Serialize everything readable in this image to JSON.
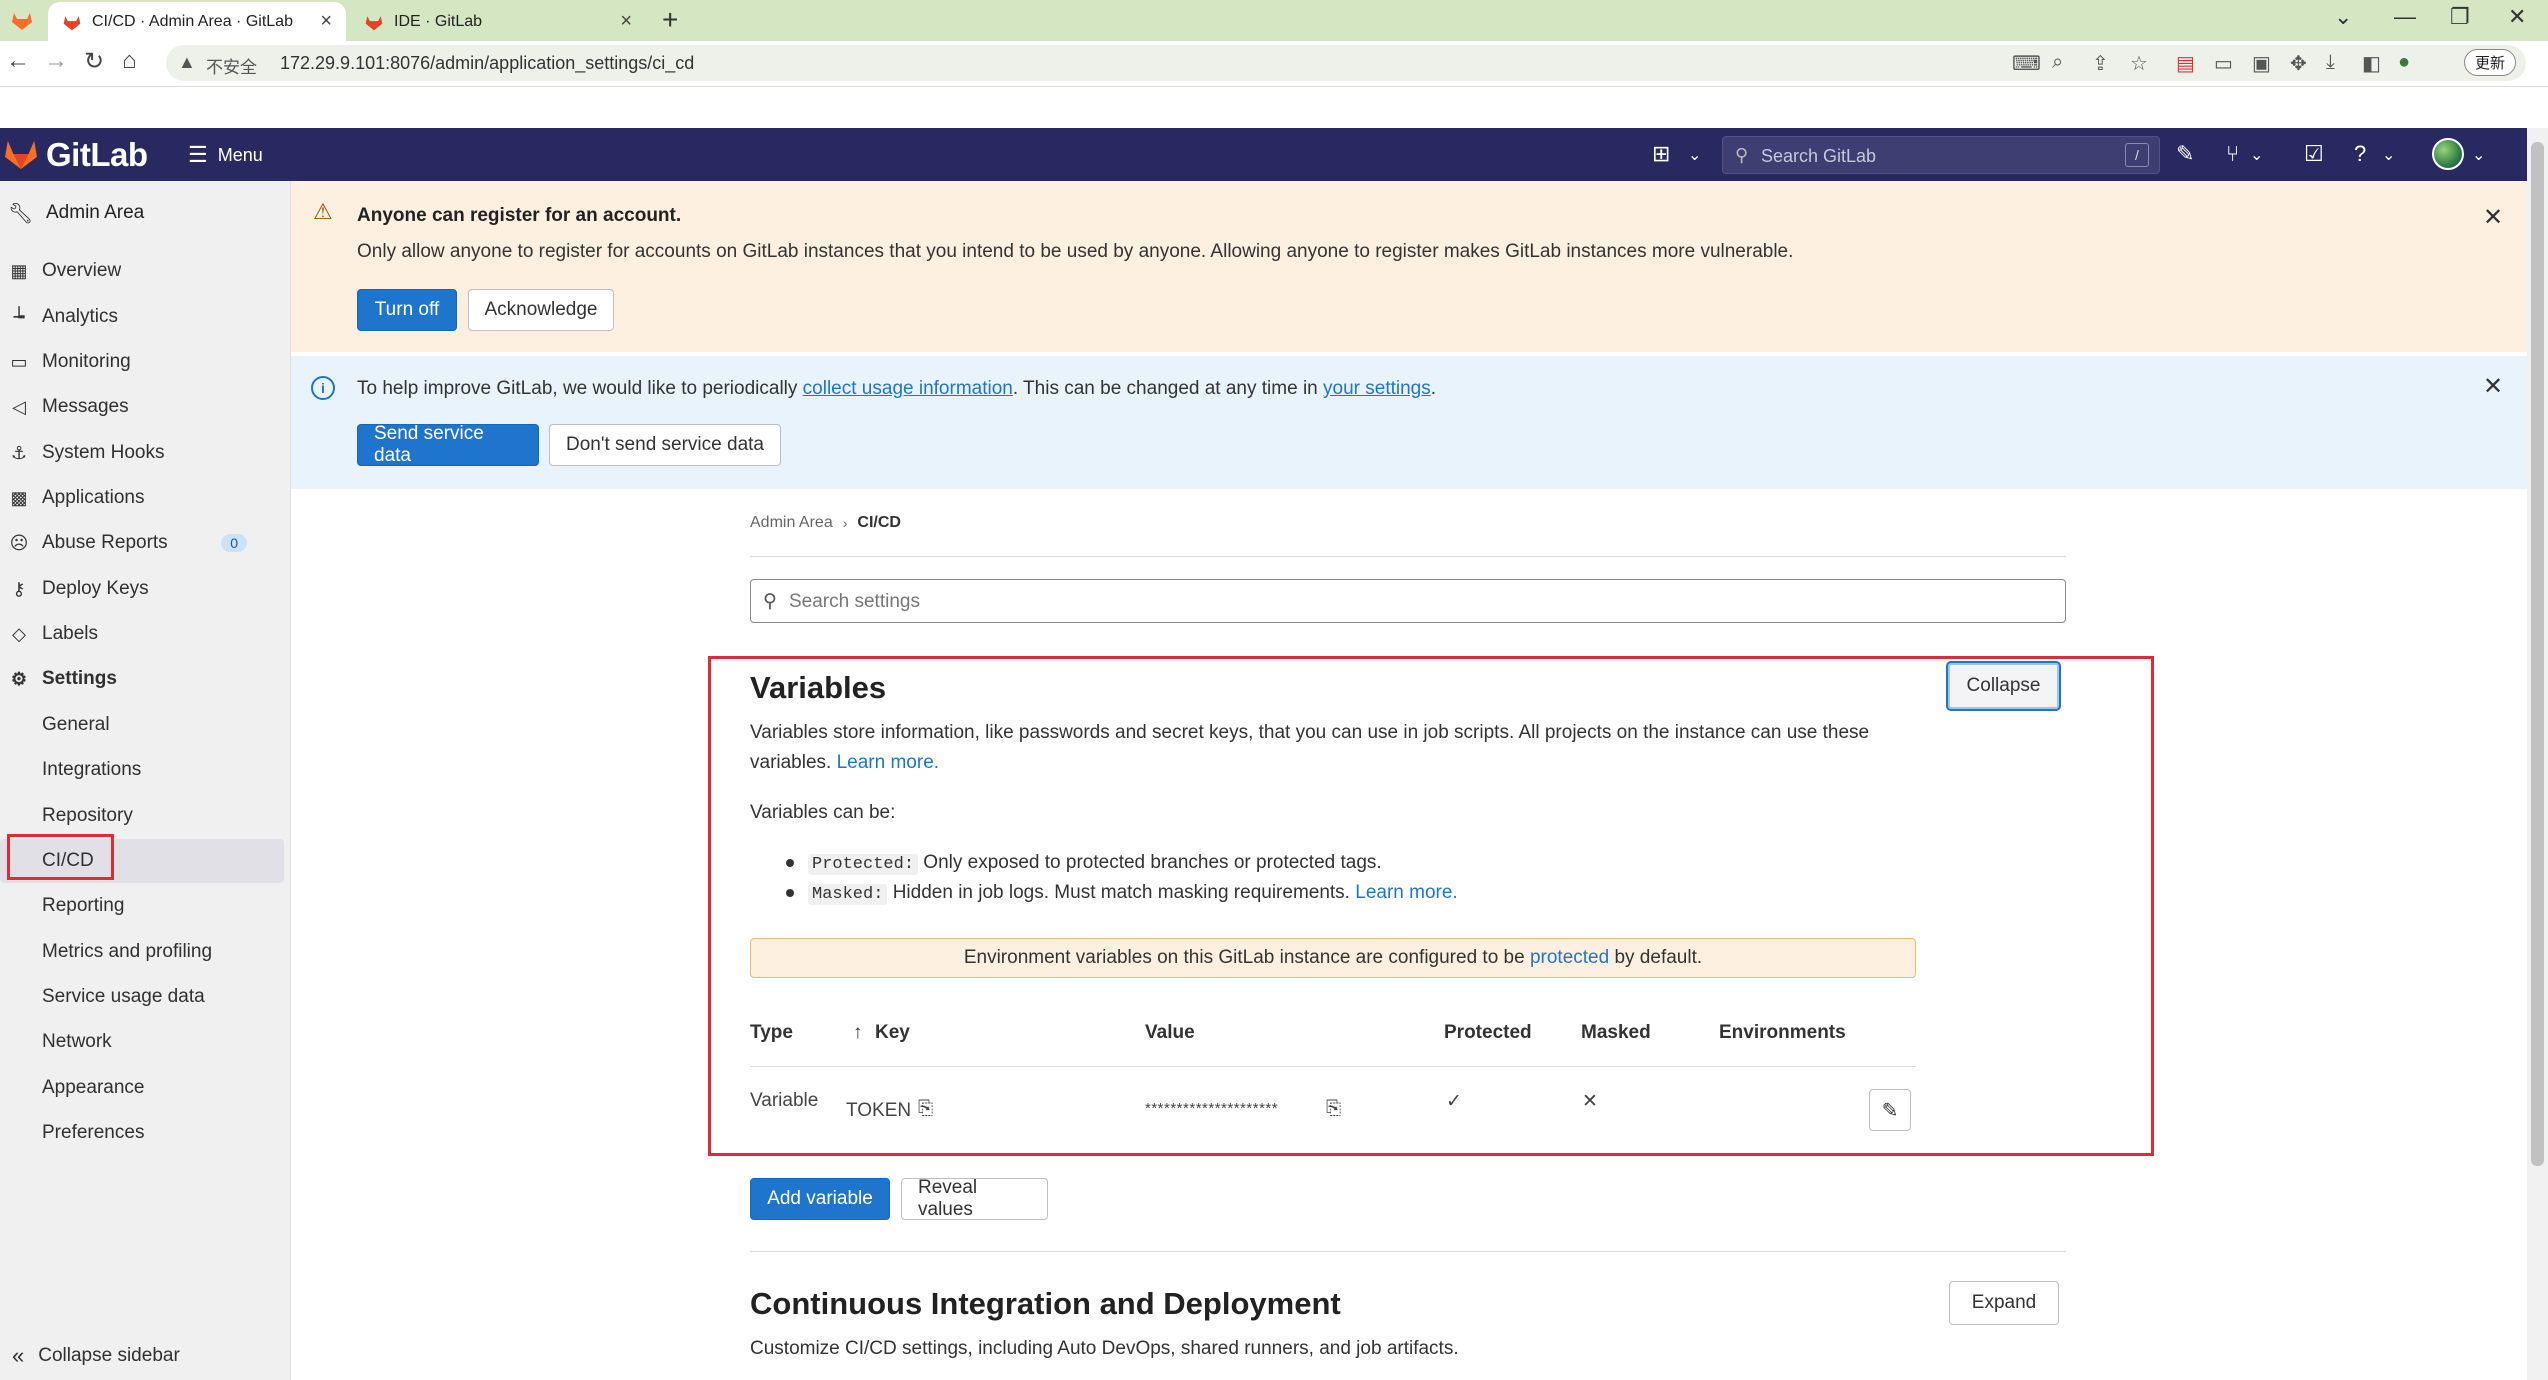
{
  "browser": {
    "tabs": [
      {
        "title": "CI/CD · Admin Area · GitLab"
      },
      {
        "title": "IDE · GitLab"
      }
    ],
    "address": {
      "security_label": "不安全",
      "url": "172.29.9.101:8076/admin/application_settings/ci_cd"
    },
    "update_label": "更新"
  },
  "header": {
    "brand": "GitLab",
    "menu_label": "Menu",
    "search_placeholder": "Search GitLab",
    "search_shortcut": "/"
  },
  "sidebar": {
    "title": "Admin Area",
    "items": [
      {
        "label": "Overview",
        "icon": "overview-icon"
      },
      {
        "label": "Analytics",
        "icon": "chart-icon"
      },
      {
        "label": "Monitoring",
        "icon": "monitor-icon"
      },
      {
        "label": "Messages",
        "icon": "bullhorn-icon"
      },
      {
        "label": "System Hooks",
        "icon": "anchor-icon"
      },
      {
        "label": "Applications",
        "icon": "applications-icon"
      },
      {
        "label": "Abuse Reports",
        "icon": "abuse-icon",
        "badge": "0"
      },
      {
        "label": "Deploy Keys",
        "icon": "key-icon"
      },
      {
        "label": "Labels",
        "icon": "label-icon"
      },
      {
        "label": "Settings",
        "icon": "settings-icon"
      }
    ],
    "settings_sub": [
      {
        "label": "General"
      },
      {
        "label": "Integrations"
      },
      {
        "label": "Repository"
      },
      {
        "label": "CI/CD"
      },
      {
        "label": "Reporting"
      },
      {
        "label": "Metrics and profiling"
      },
      {
        "label": "Service usage data"
      },
      {
        "label": "Network"
      },
      {
        "label": "Appearance"
      },
      {
        "label": "Preferences"
      }
    ],
    "collapse_label": "Collapse sidebar"
  },
  "banner_register": {
    "title": "Anyone can register for an account.",
    "body": "Only allow anyone to register for accounts on GitLab instances that you intend to be used by anyone. Allowing anyone to register makes GitLab instances more vulnerable.",
    "turn_off": "Turn off",
    "acknowledge": "Acknowledge"
  },
  "banner_usage": {
    "text_before": "To help improve GitLab, we would like to periodically ",
    "link1": "collect usage information",
    "text_middle": ". This can be changed at any time in ",
    "link2": "your settings",
    "text_after": ".",
    "send": "Send service data",
    "dont_send": "Don't send service data"
  },
  "breadcrumb": {
    "root": "Admin Area",
    "current": "CI/CD"
  },
  "settings_search_placeholder": "Search settings",
  "variables": {
    "title": "Variables",
    "collapse": "Collapse",
    "desc_line1": "Variables store information, like passwords and secret keys, that you can use in job scripts. All projects on the instance can use these",
    "desc_line2": "variables.",
    "learn_more": "Learn more.",
    "can_be": "Variables can be:",
    "protected_tag": "Protected:",
    "protected_desc": " Only exposed to protected branches or protected tags.",
    "masked_tag": "Masked:",
    "masked_desc": " Hidden in job logs. Must match masking requirements.",
    "learn_more2": "Learn more.",
    "alert_before": "Environment variables on this GitLab instance are configured to be ",
    "alert_link": "protected",
    "alert_after": " by default.",
    "columns": [
      "Type",
      "Key",
      "Value",
      "Protected",
      "Masked",
      "Environments"
    ],
    "rows": [
      {
        "type": "Variable",
        "key": "TOKEN",
        "value": "*********************",
        "protected": "✓",
        "masked": "✕",
        "environments": ""
      }
    ],
    "add_variable": "Add variable",
    "reveal_values": "Reveal values"
  },
  "ci_section": {
    "title": "Continuous Integration and Deployment",
    "expand": "Expand",
    "desc": "Customize CI/CD settings, including Auto DevOps, shared runners, and job artifacts."
  },
  "colors": {
    "header_bg": "#292961",
    "primary": "#1f75cb",
    "highlight": "#dd2b3a"
  }
}
